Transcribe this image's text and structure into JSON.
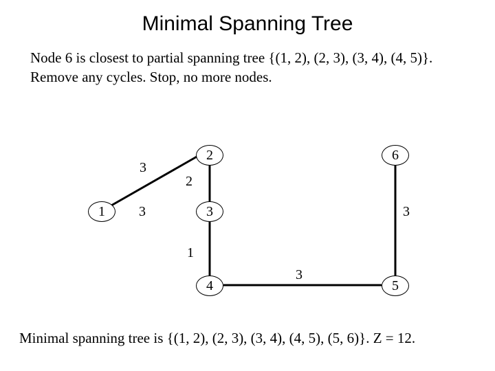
{
  "title": "Minimal Spanning Tree",
  "description": "Node 6 is closest to partial spanning tree {(1, 2), (2, 3), (3, 4), (4, 5)}. Remove any cycles. Stop, no more nodes.",
  "footer": "Minimal spanning tree is {(1, 2), (2, 3), (3, 4), (4, 5), (5, 6)}. Z = 12.",
  "nodes": {
    "n1": "1",
    "n2": "2",
    "n3": "3",
    "n4": "4",
    "n5": "5",
    "n6": "6"
  },
  "edge_weights": {
    "w12": "3",
    "w23": "2",
    "w34": "1",
    "w13": "3",
    "w45": "3",
    "w56": "3"
  },
  "chart_data": {
    "type": "graph",
    "title": "Minimal Spanning Tree",
    "nodes": [
      1,
      2,
      3,
      4,
      5,
      6
    ],
    "edges": [
      {
        "from": 1,
        "to": 2,
        "weight": 3,
        "in_tree": true
      },
      {
        "from": 2,
        "to": 3,
        "weight": 2,
        "in_tree": true
      },
      {
        "from": 3,
        "to": 4,
        "weight": 1,
        "in_tree": true
      },
      {
        "from": 4,
        "to": 5,
        "weight": 3,
        "in_tree": true
      },
      {
        "from": 5,
        "to": 6,
        "weight": 3,
        "in_tree": true
      },
      {
        "from": 1,
        "to": 3,
        "weight": 3,
        "in_tree": false
      }
    ],
    "total_cost": 12
  }
}
